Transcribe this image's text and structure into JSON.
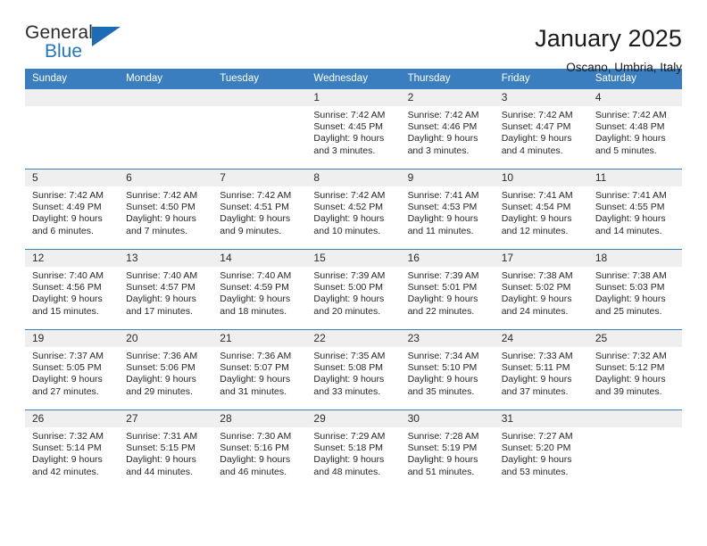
{
  "brand": {
    "name_part1": "General",
    "name_part2": "Blue",
    "flag_icon": "triangle-flag-icon"
  },
  "header": {
    "title": "January 2025",
    "subtitle": "Oscano, Umbria, Italy"
  },
  "calendar": {
    "weekday_headers": [
      "Sunday",
      "Monday",
      "Tuesday",
      "Wednesday",
      "Thursday",
      "Friday",
      "Saturday"
    ],
    "labels": {
      "sunrise": "Sunrise:",
      "sunset": "Sunset:",
      "daylight": "Daylight:"
    },
    "accent_color": "#3a7ebf",
    "daynum_bg": "#efefef",
    "weeks": [
      [
        {
          "day": "",
          "sunrise": "",
          "sunset": "",
          "daylight_line1": "",
          "daylight_line2": ""
        },
        {
          "day": "",
          "sunrise": "",
          "sunset": "",
          "daylight_line1": "",
          "daylight_line2": ""
        },
        {
          "day": "",
          "sunrise": "",
          "sunset": "",
          "daylight_line1": "",
          "daylight_line2": ""
        },
        {
          "day": "1",
          "sunrise": "Sunrise: 7:42 AM",
          "sunset": "Sunset: 4:45 PM",
          "daylight_line1": "Daylight: 9 hours",
          "daylight_line2": "and 3 minutes."
        },
        {
          "day": "2",
          "sunrise": "Sunrise: 7:42 AM",
          "sunset": "Sunset: 4:46 PM",
          "daylight_line1": "Daylight: 9 hours",
          "daylight_line2": "and 3 minutes."
        },
        {
          "day": "3",
          "sunrise": "Sunrise: 7:42 AM",
          "sunset": "Sunset: 4:47 PM",
          "daylight_line1": "Daylight: 9 hours",
          "daylight_line2": "and 4 minutes."
        },
        {
          "day": "4",
          "sunrise": "Sunrise: 7:42 AM",
          "sunset": "Sunset: 4:48 PM",
          "daylight_line1": "Daylight: 9 hours",
          "daylight_line2": "and 5 minutes."
        }
      ],
      [
        {
          "day": "5",
          "sunrise": "Sunrise: 7:42 AM",
          "sunset": "Sunset: 4:49 PM",
          "daylight_line1": "Daylight: 9 hours",
          "daylight_line2": "and 6 minutes."
        },
        {
          "day": "6",
          "sunrise": "Sunrise: 7:42 AM",
          "sunset": "Sunset: 4:50 PM",
          "daylight_line1": "Daylight: 9 hours",
          "daylight_line2": "and 7 minutes."
        },
        {
          "day": "7",
          "sunrise": "Sunrise: 7:42 AM",
          "sunset": "Sunset: 4:51 PM",
          "daylight_line1": "Daylight: 9 hours",
          "daylight_line2": "and 9 minutes."
        },
        {
          "day": "8",
          "sunrise": "Sunrise: 7:42 AM",
          "sunset": "Sunset: 4:52 PM",
          "daylight_line1": "Daylight: 9 hours",
          "daylight_line2": "and 10 minutes."
        },
        {
          "day": "9",
          "sunrise": "Sunrise: 7:41 AM",
          "sunset": "Sunset: 4:53 PM",
          "daylight_line1": "Daylight: 9 hours",
          "daylight_line2": "and 11 minutes."
        },
        {
          "day": "10",
          "sunrise": "Sunrise: 7:41 AM",
          "sunset": "Sunset: 4:54 PM",
          "daylight_line1": "Daylight: 9 hours",
          "daylight_line2": "and 12 minutes."
        },
        {
          "day": "11",
          "sunrise": "Sunrise: 7:41 AM",
          "sunset": "Sunset: 4:55 PM",
          "daylight_line1": "Daylight: 9 hours",
          "daylight_line2": "and 14 minutes."
        }
      ],
      [
        {
          "day": "12",
          "sunrise": "Sunrise: 7:40 AM",
          "sunset": "Sunset: 4:56 PM",
          "daylight_line1": "Daylight: 9 hours",
          "daylight_line2": "and 15 minutes."
        },
        {
          "day": "13",
          "sunrise": "Sunrise: 7:40 AM",
          "sunset": "Sunset: 4:57 PM",
          "daylight_line1": "Daylight: 9 hours",
          "daylight_line2": "and 17 minutes."
        },
        {
          "day": "14",
          "sunrise": "Sunrise: 7:40 AM",
          "sunset": "Sunset: 4:59 PM",
          "daylight_line1": "Daylight: 9 hours",
          "daylight_line2": "and 18 minutes."
        },
        {
          "day": "15",
          "sunrise": "Sunrise: 7:39 AM",
          "sunset": "Sunset: 5:00 PM",
          "daylight_line1": "Daylight: 9 hours",
          "daylight_line2": "and 20 minutes."
        },
        {
          "day": "16",
          "sunrise": "Sunrise: 7:39 AM",
          "sunset": "Sunset: 5:01 PM",
          "daylight_line1": "Daylight: 9 hours",
          "daylight_line2": "and 22 minutes."
        },
        {
          "day": "17",
          "sunrise": "Sunrise: 7:38 AM",
          "sunset": "Sunset: 5:02 PM",
          "daylight_line1": "Daylight: 9 hours",
          "daylight_line2": "and 24 minutes."
        },
        {
          "day": "18",
          "sunrise": "Sunrise: 7:38 AM",
          "sunset": "Sunset: 5:03 PM",
          "daylight_line1": "Daylight: 9 hours",
          "daylight_line2": "and 25 minutes."
        }
      ],
      [
        {
          "day": "19",
          "sunrise": "Sunrise: 7:37 AM",
          "sunset": "Sunset: 5:05 PM",
          "daylight_line1": "Daylight: 9 hours",
          "daylight_line2": "and 27 minutes."
        },
        {
          "day": "20",
          "sunrise": "Sunrise: 7:36 AM",
          "sunset": "Sunset: 5:06 PM",
          "daylight_line1": "Daylight: 9 hours",
          "daylight_line2": "and 29 minutes."
        },
        {
          "day": "21",
          "sunrise": "Sunrise: 7:36 AM",
          "sunset": "Sunset: 5:07 PM",
          "daylight_line1": "Daylight: 9 hours",
          "daylight_line2": "and 31 minutes."
        },
        {
          "day": "22",
          "sunrise": "Sunrise: 7:35 AM",
          "sunset": "Sunset: 5:08 PM",
          "daylight_line1": "Daylight: 9 hours",
          "daylight_line2": "and 33 minutes."
        },
        {
          "day": "23",
          "sunrise": "Sunrise: 7:34 AM",
          "sunset": "Sunset: 5:10 PM",
          "daylight_line1": "Daylight: 9 hours",
          "daylight_line2": "and 35 minutes."
        },
        {
          "day": "24",
          "sunrise": "Sunrise: 7:33 AM",
          "sunset": "Sunset: 5:11 PM",
          "daylight_line1": "Daylight: 9 hours",
          "daylight_line2": "and 37 minutes."
        },
        {
          "day": "25",
          "sunrise": "Sunrise: 7:32 AM",
          "sunset": "Sunset: 5:12 PM",
          "daylight_line1": "Daylight: 9 hours",
          "daylight_line2": "and 39 minutes."
        }
      ],
      [
        {
          "day": "26",
          "sunrise": "Sunrise: 7:32 AM",
          "sunset": "Sunset: 5:14 PM",
          "daylight_line1": "Daylight: 9 hours",
          "daylight_line2": "and 42 minutes."
        },
        {
          "day": "27",
          "sunrise": "Sunrise: 7:31 AM",
          "sunset": "Sunset: 5:15 PM",
          "daylight_line1": "Daylight: 9 hours",
          "daylight_line2": "and 44 minutes."
        },
        {
          "day": "28",
          "sunrise": "Sunrise: 7:30 AM",
          "sunset": "Sunset: 5:16 PM",
          "daylight_line1": "Daylight: 9 hours",
          "daylight_line2": "and 46 minutes."
        },
        {
          "day": "29",
          "sunrise": "Sunrise: 7:29 AM",
          "sunset": "Sunset: 5:18 PM",
          "daylight_line1": "Daylight: 9 hours",
          "daylight_line2": "and 48 minutes."
        },
        {
          "day": "30",
          "sunrise": "Sunrise: 7:28 AM",
          "sunset": "Sunset: 5:19 PM",
          "daylight_line1": "Daylight: 9 hours",
          "daylight_line2": "and 51 minutes."
        },
        {
          "day": "31",
          "sunrise": "Sunrise: 7:27 AM",
          "sunset": "Sunset: 5:20 PM",
          "daylight_line1": "Daylight: 9 hours",
          "daylight_line2": "and 53 minutes."
        },
        {
          "day": "",
          "sunrise": "",
          "sunset": "",
          "daylight_line1": "",
          "daylight_line2": ""
        }
      ]
    ]
  }
}
